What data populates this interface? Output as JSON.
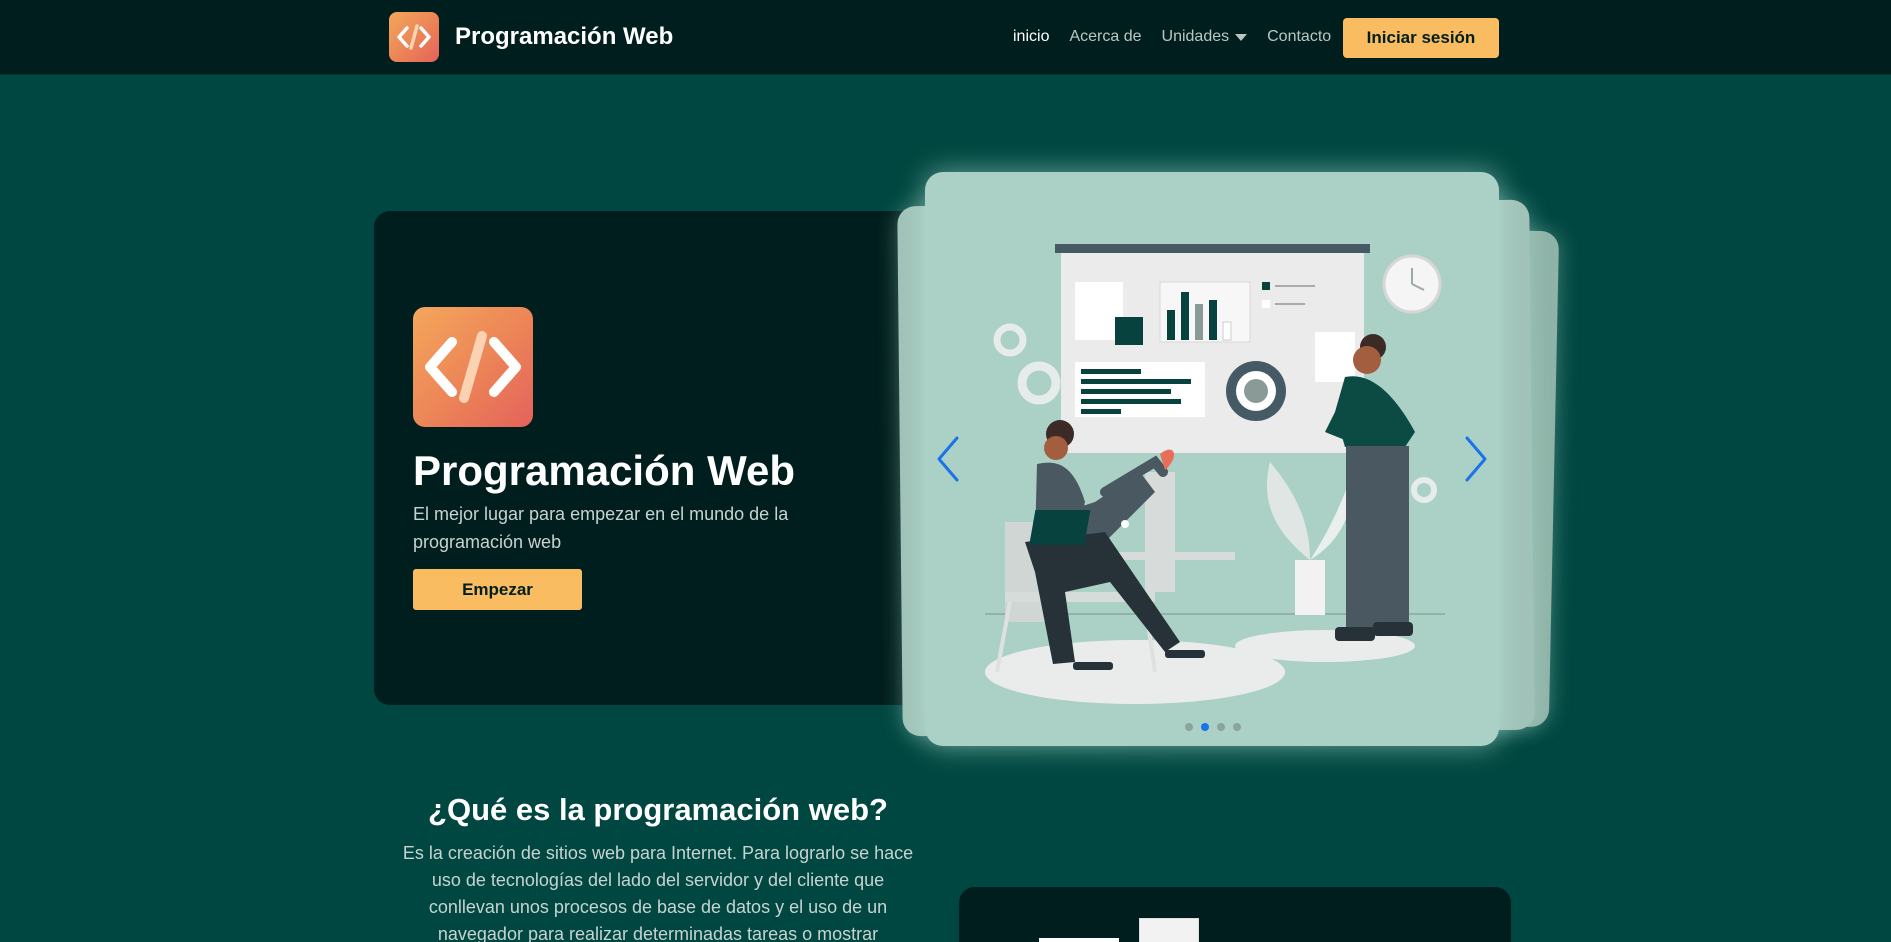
{
  "nav": {
    "brand": "Programación Web",
    "links": [
      "inicio",
      "Acerca de",
      "Unidades",
      "Contacto"
    ],
    "login": "Iniciar sesión"
  },
  "hero": {
    "title": "Programación Web",
    "subtitle": "El mejor lugar para empezar en el mundo de la programación web",
    "button": "Empezar"
  },
  "carousel": {
    "slide_count": 4,
    "active_index": 1
  },
  "section": {
    "title": "¿Qué es la programación web?",
    "body": "Es la creación de sitios web para Internet. Para lograrlo se hace uso de tecnologías del lado del servidor y del cliente que conllevan unos procesos de base de datos y el uso de un navegador para realizar determinadas tareas o mostrar información"
  },
  "colors": {
    "background": "#004741",
    "card": "#001e1d",
    "accent": "#f9bc60",
    "carousel": "#abd1c6"
  }
}
